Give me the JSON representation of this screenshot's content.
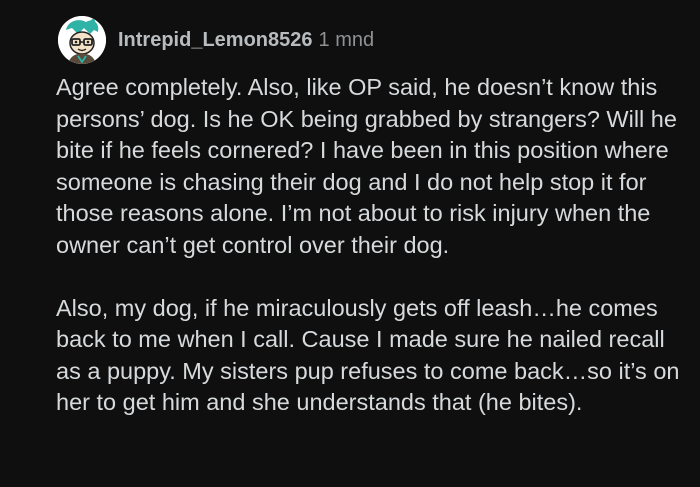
{
  "comment": {
    "author": {
      "username": "Intrepid_Lemon8526",
      "avatar_icon": "cartoon-avatar-icon"
    },
    "timestamp": "1 mnd",
    "paragraphs": [
      "Agree completely. Also, like OP said, he doesn’t know this persons’ dog. Is he OK being grabbed by strangers? Will he bite if he feels cornered? I have been in this position where someone is chasing their dog and I do not help stop it for those reasons alone. I’m not about to risk injury when the owner can’t get control over their dog.",
      "Also, my dog, if he miraculously gets off leash…he comes back to me when I call. Cause I made sure he nailed recall as a puppy. My sisters pup refuses to come back…so it’s on her to get him and she understands that (he bites)."
    ]
  },
  "colors": {
    "background": "#0f0f0f",
    "text": "#d7dadc",
    "username": "#b9bcbe",
    "timestamp": "#8f9295"
  }
}
